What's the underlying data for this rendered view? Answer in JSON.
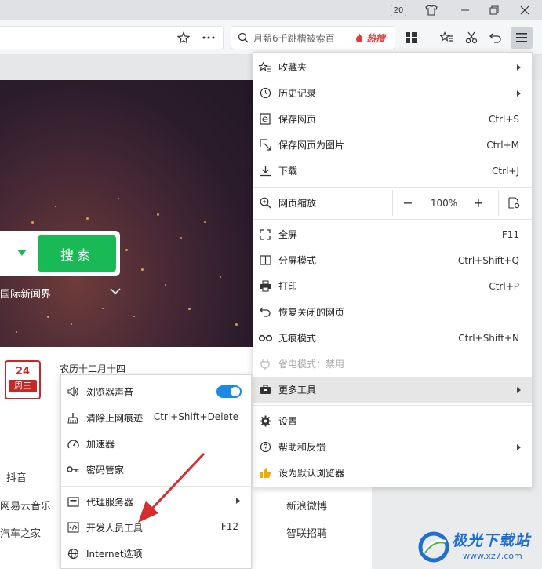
{
  "titlebar": {
    "tab_count": "20"
  },
  "toolbar": {
    "search_text": "月薪6千跳槽被索百",
    "hot_badge": "热搜"
  },
  "hero": {
    "search_button": "搜索",
    "news_link": "国际新闻界"
  },
  "calendar": {
    "day": "24",
    "weekday": "周三",
    "lunar": "农历十二月十四"
  },
  "sites": [
    "抖音",
    "网易云音乐",
    "汽车之家",
    "新浪微博",
    "智联招聘"
  ],
  "menu": {
    "items": [
      {
        "label": "收藏夹",
        "shortcut": "",
        "submenu": true,
        "icon": "star-list-icon"
      },
      {
        "label": "历史记录",
        "shortcut": "",
        "submenu": true,
        "icon": "clock-icon"
      },
      {
        "label": "保存网页",
        "shortcut": "Ctrl+S",
        "submenu": false,
        "icon": "save-page-icon"
      },
      {
        "label": "保存网页为图片",
        "shortcut": "Ctrl+M",
        "submenu": false,
        "icon": "save-image-icon"
      },
      {
        "label": "下载",
        "shortcut": "Ctrl+J",
        "submenu": false,
        "icon": "download-icon"
      }
    ],
    "zoom": {
      "label": "网页缩放",
      "value": "100%",
      "minus": "−",
      "plus": "+"
    },
    "items2": [
      {
        "label": "全屏",
        "shortcut": "F11",
        "submenu": false,
        "icon": "fullscreen-icon"
      },
      {
        "label": "分屏模式",
        "shortcut": "Ctrl+Shift+Q",
        "submenu": false,
        "icon": "split-screen-icon"
      },
      {
        "label": "打印",
        "shortcut": "Ctrl+P",
        "submenu": false,
        "icon": "printer-icon"
      },
      {
        "label": "恢复关闭的网页",
        "shortcut": "",
        "submenu": false,
        "icon": "undo-icon"
      },
      {
        "label": "无痕模式",
        "shortcut": "Ctrl+Shift+N",
        "submenu": false,
        "icon": "incognito-icon"
      },
      {
        "label": "省电模式：禁用",
        "shortcut": "",
        "submenu": false,
        "icon": "power-save-icon"
      },
      {
        "label": "更多工具",
        "shortcut": "",
        "submenu": true,
        "icon": "toolbox-icon"
      }
    ],
    "items3": [
      {
        "label": "设置",
        "shortcut": "",
        "submenu": false,
        "icon": "gear-icon"
      },
      {
        "label": "帮助和反馈",
        "shortcut": "",
        "submenu": true,
        "icon": "help-icon"
      },
      {
        "label": "设为默认浏览器",
        "shortcut": "",
        "submenu": false,
        "icon": "thumbs-up-icon"
      }
    ]
  },
  "submenu": {
    "items": [
      {
        "label": "浏览器声音",
        "shortcut": "",
        "toggle": true,
        "icon": "speaker-icon"
      },
      {
        "label": "清除上网痕迹",
        "shortcut": "Ctrl+Shift+Delete",
        "icon": "broom-icon"
      },
      {
        "label": "加速器",
        "shortcut": "",
        "icon": "speedometer-icon"
      },
      {
        "label": "密码管家",
        "shortcut": "",
        "icon": "key-icon"
      },
      {
        "label": "代理服务器",
        "shortcut": "",
        "submenu": true,
        "icon": "proxy-icon"
      },
      {
        "label": "开发人员工具",
        "shortcut": "F12",
        "icon": "devtools-icon"
      },
      {
        "label": "Internet选项",
        "shortcut": "",
        "icon": "globe-icon"
      }
    ]
  },
  "watermark": {
    "title": "极光下载站",
    "url": "www.xz7.com"
  },
  "colors": {
    "accent_green": "#19b955",
    "toggle_blue": "#1e88e5",
    "highlight": "#e6e6e6",
    "arrow_red": "#d32f2f"
  }
}
